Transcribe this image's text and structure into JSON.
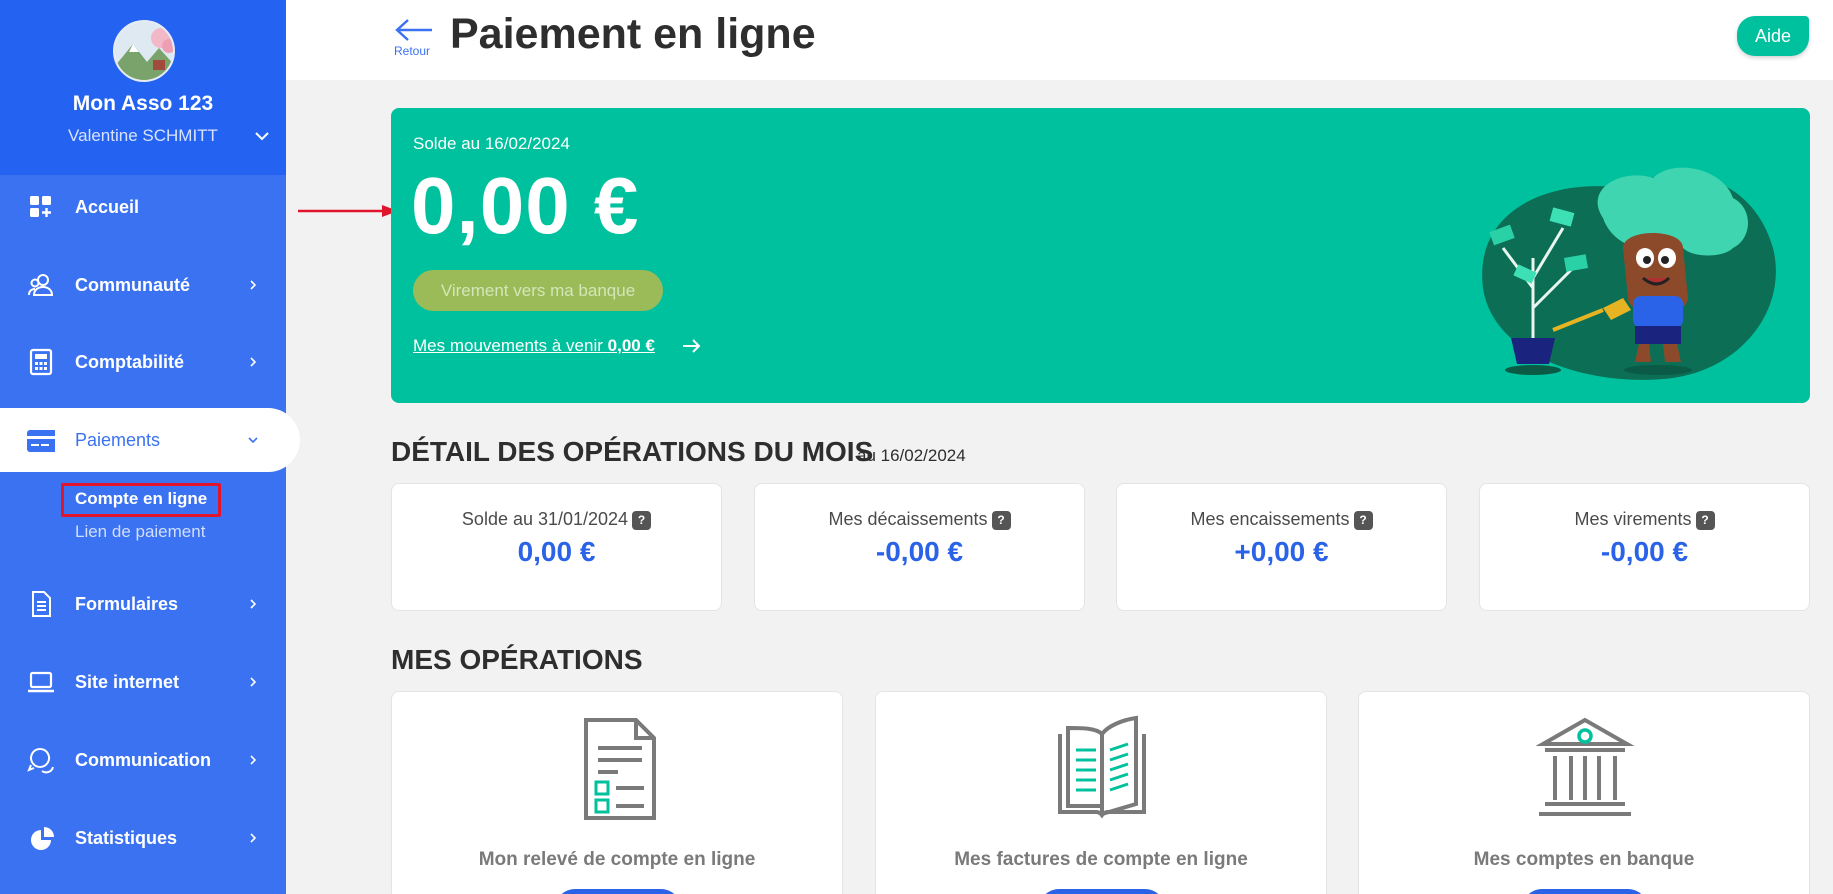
{
  "sidebar": {
    "org_name": "Mon Asso 123",
    "user_name": "Valentine SCHMITT",
    "items": [
      {
        "label": "Accueil",
        "icon": "dashboard-icon"
      },
      {
        "label": "Communauté",
        "icon": "community-icon"
      },
      {
        "label": "Comptabilité",
        "icon": "calculator-icon"
      },
      {
        "label": "Paiements",
        "icon": "credit-card-icon"
      },
      {
        "label": "Formulaires",
        "icon": "document-icon"
      },
      {
        "label": "Site internet",
        "icon": "laptop-icon"
      },
      {
        "label": "Communication",
        "icon": "chat-icon"
      },
      {
        "label": "Statistiques",
        "icon": "pie-chart-icon"
      }
    ],
    "sub_items": [
      {
        "label": "Compte en ligne"
      },
      {
        "label": "Lien de paiement"
      }
    ]
  },
  "header": {
    "back_label": "Retour",
    "title": "Paiement en ligne",
    "help_label": "Aide"
  },
  "balance": {
    "date_label": "Solde au 16/02/2024",
    "amount": "0,00 €",
    "transfer_button": "Virement vers ma banque",
    "upcoming_label": "Mes mouvements à venir",
    "upcoming_amount": "0,00 €"
  },
  "details": {
    "title": "DÉTAIL DES OPÉRATIONS DU MOIS",
    "subtitle": "au 16/02/2024",
    "cards": [
      {
        "label": "Solde au 31/01/2024",
        "value": "0,00 €"
      },
      {
        "label": "Mes décaissements",
        "value": "-0,00 €"
      },
      {
        "label": "Mes encaissements",
        "value": "+0,00 €"
      },
      {
        "label": "Mes virements",
        "value": "-0,00 €"
      }
    ],
    "help_glyph": "?"
  },
  "operations": {
    "title": "MES OPÉRATIONS",
    "cards": [
      {
        "label": "Mon relevé de compte en ligne",
        "icon": "statement-icon"
      },
      {
        "label": "Mes factures de compte en ligne",
        "icon": "open-book-icon"
      },
      {
        "label": "Mes comptes en banque",
        "icon": "bank-icon"
      }
    ]
  },
  "colors": {
    "sidebar": "#3b72f2",
    "sidebar_header": "#2463f1",
    "accent_green": "#00c19e",
    "value_blue": "#2b63e8",
    "annotation_red": "#e0142a"
  }
}
